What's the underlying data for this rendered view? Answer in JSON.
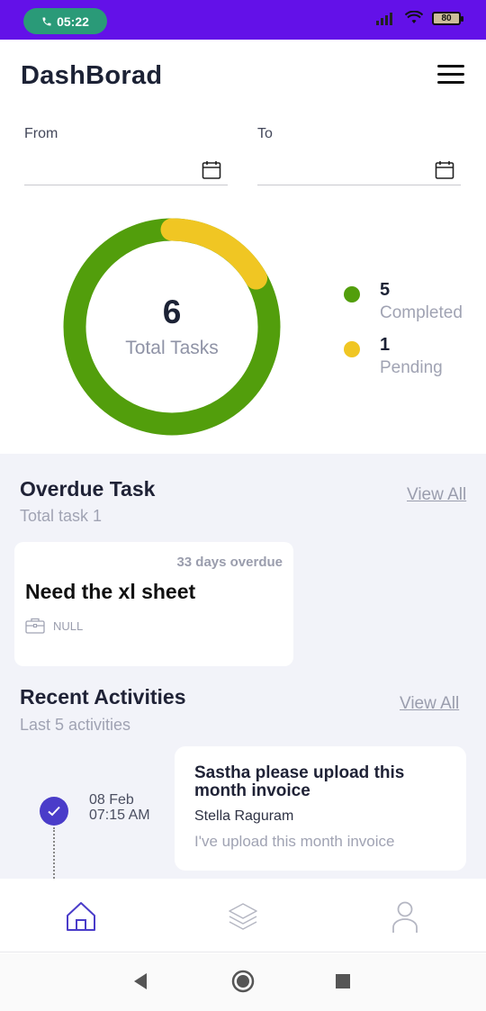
{
  "status_bar": {
    "time": "05:22",
    "battery": "80",
    "accent_color": "#6311e8",
    "call_color": "#2a9a78"
  },
  "header": {
    "title": "DashBorad",
    "menu_icon": "hamburger-menu-icon"
  },
  "date_range": {
    "from_label": "From",
    "from_value": "",
    "to_label": "To",
    "to_value": "",
    "icon": "calendar-icon"
  },
  "summary": {
    "total": "6",
    "total_label": "Total Tasks",
    "completed_value": "5",
    "completed_label": "Completed",
    "pending_value": "1",
    "pending_label": "Pending",
    "completed_color": "#529e0c",
    "pending_color": "#f0c623"
  },
  "overdue": {
    "title": "Overdue Task",
    "subtitle": "Total task 1",
    "view_all": "View All",
    "task": {
      "overdue_text": "33 days overdue",
      "title": "Need the xl sheet",
      "project": "NULL",
      "project_icon": "briefcase-icon"
    }
  },
  "activities": {
    "title": "Recent Activities",
    "subtitle": "Last 5 activities",
    "view_all": "View All",
    "items": [
      {
        "date": "08 Feb",
        "time": "07:15 AM",
        "title": "Sastha please upload this month invoice",
        "user": "Stella Raguram",
        "message": "I've upload this month invoice"
      }
    ]
  },
  "bottom_nav": {
    "items": [
      {
        "icon": "home-icon",
        "active": true
      },
      {
        "icon": "layers-icon",
        "active": false
      },
      {
        "icon": "profile-icon",
        "active": false
      }
    ]
  }
}
